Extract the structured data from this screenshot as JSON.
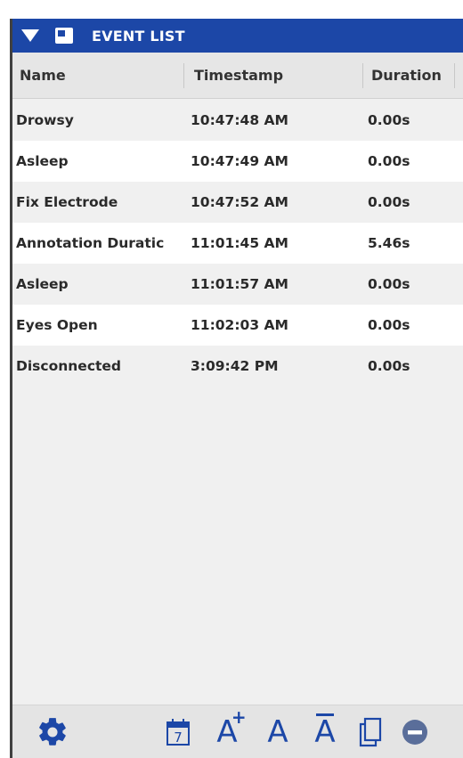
{
  "panel": {
    "title": "EVENT LIST",
    "accent_color": "#1c47a7"
  },
  "columns": {
    "name": "Name",
    "timestamp": "Timestamp",
    "duration": "Duration"
  },
  "rows": [
    {
      "name": "Drowsy",
      "timestamp": "10:47:48 AM",
      "duration": "0.00s"
    },
    {
      "name": "Asleep",
      "timestamp": "10:47:49 AM",
      "duration": "0.00s"
    },
    {
      "name": "Fix Electrode",
      "timestamp": "10:47:52 AM",
      "duration": "0.00s"
    },
    {
      "name": "Annotation Duratic",
      "timestamp": "11:01:45 AM",
      "duration": "5.46s"
    },
    {
      "name": "Asleep",
      "timestamp": "11:01:57 AM",
      "duration": "0.00s"
    },
    {
      "name": "Eyes Open",
      "timestamp": "11:02:03 AM",
      "duration": "0.00s"
    },
    {
      "name": "Disconnected",
      "timestamp": "3:09:42 PM",
      "duration": "0.00s"
    }
  ],
  "toolbar": {
    "icons": [
      "gear-icon",
      "calendar-icon",
      "font-increase-icon",
      "font-reset-icon",
      "font-decrease-icon",
      "copy-icon",
      "remove-icon"
    ],
    "calendar_day": "7",
    "font_letter": "A",
    "increase_mark": "+"
  }
}
